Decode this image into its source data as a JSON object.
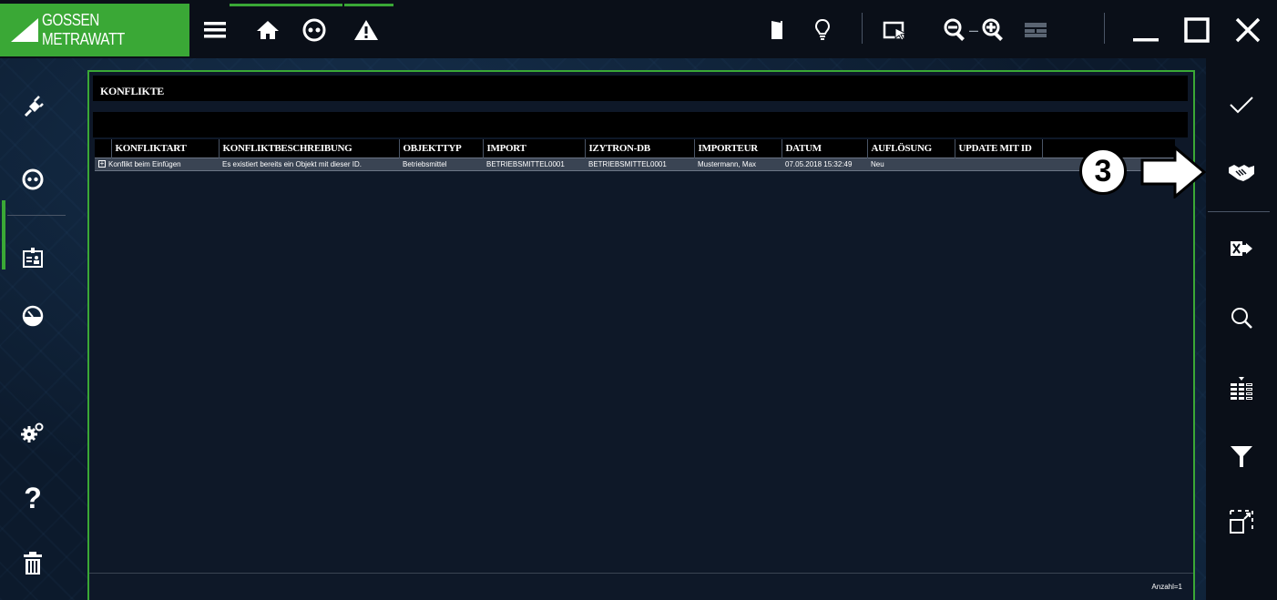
{
  "app": {
    "brand": "GOSSEN METRAWATT",
    "accent_color": "#3aa836",
    "background_color": "#0d1726"
  },
  "toolbar": {
    "left_icons": [
      "menu-icon",
      "home-icon",
      "socket-icon",
      "warning-icon"
    ],
    "right_icons": [
      "exit-door-icon",
      "lightbulb-icon",
      "select-cursor-icon",
      "zoom-out-icon",
      "zoom-in-icon",
      "layout-icon",
      "minimize-icon",
      "maximize-icon",
      "close-icon"
    ],
    "zoom_separator": "–"
  },
  "sidebar_left": {
    "items": [
      "plug-icon",
      "socket-icon",
      "badge-icon",
      "gauge-icon",
      "gears-icon",
      "help-icon",
      "trash-icon"
    ],
    "help_label": "?"
  },
  "sidebar_right": {
    "items": [
      "check-icon",
      "handshake-icon",
      "excel-export-icon",
      "search-icon",
      "column-chooser-icon",
      "filter-icon",
      "fullscreen-icon"
    ]
  },
  "panel": {
    "title": "KONFLIKTE",
    "columns": [
      "KONFLIKTART",
      "KONFLIKTBESCHREIBUNG",
      "OBJEKTTYP",
      "IMPORT",
      "IZYTRON-DB",
      "IMPORTEUR",
      "DATUM",
      "AUFLÖSUNG",
      "UPDATE MIT ID"
    ],
    "rows": [
      {
        "konfliktart": "Konflikt beim Einfügen",
        "beschreibung": "Es existiert bereits ein Objekt mit dieser ID.",
        "objekttyp": "Betriebsmittel",
        "import": "BETRIEBSMITTEL0001",
        "izytron_db": "BETRIEBSMITTEL0001",
        "importeur": "Mustermann, Max",
        "datum": "07.05.2018 15:32:49",
        "aufloesung": "Neu",
        "update_mit_id": ""
      }
    ],
    "count_label": "Anzahl=1"
  },
  "callout": {
    "number": "3"
  }
}
